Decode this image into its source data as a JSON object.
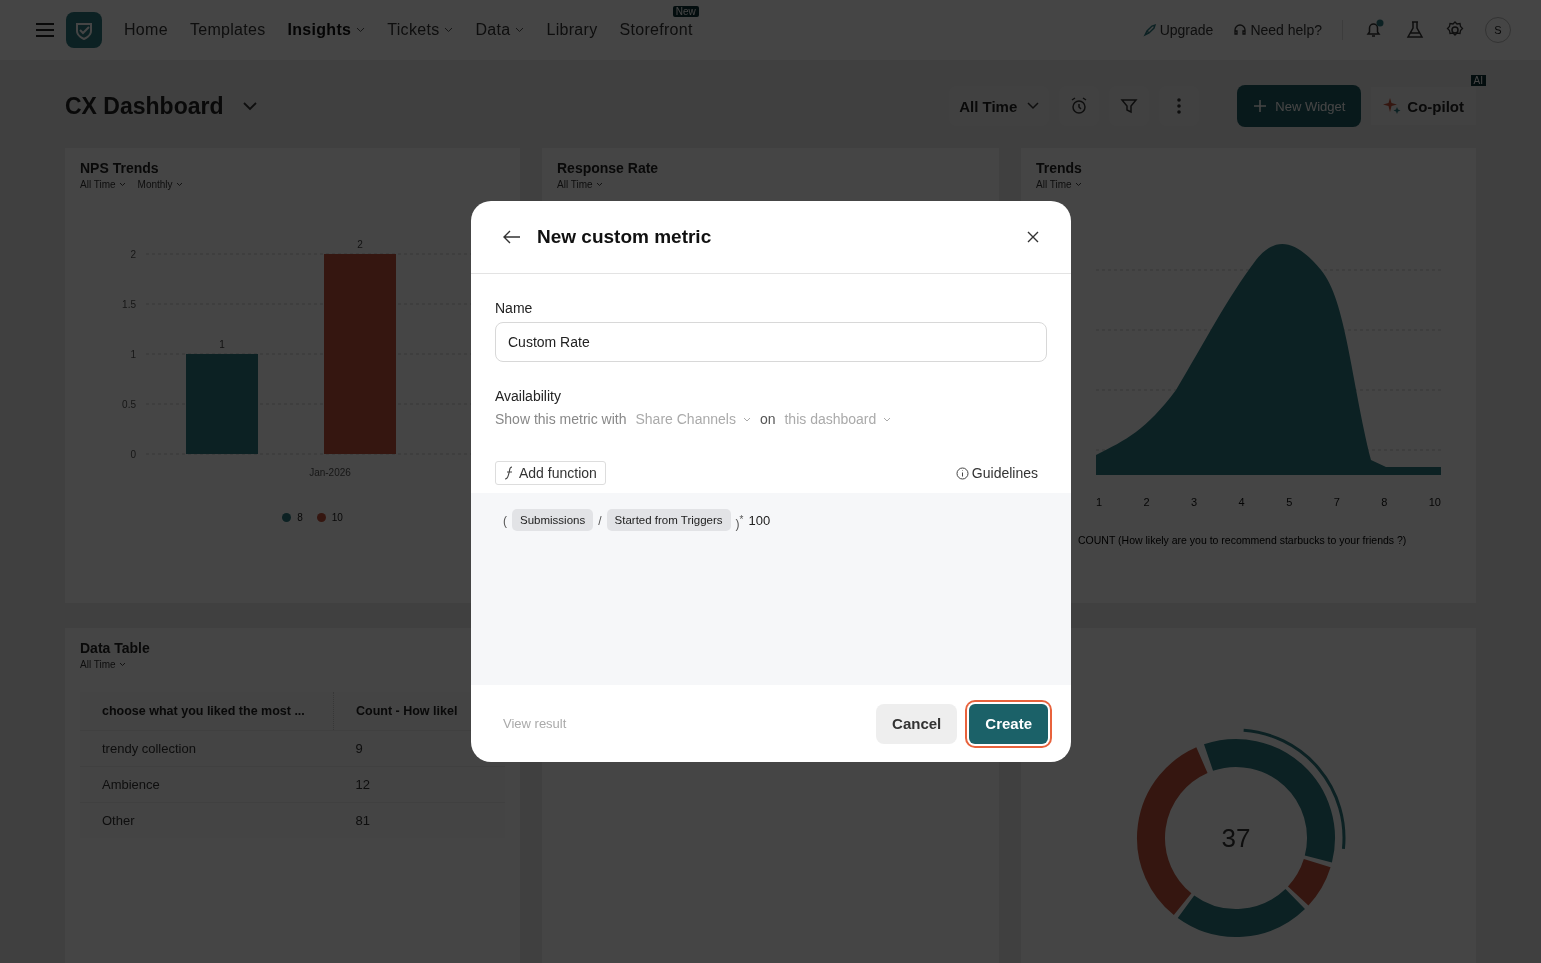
{
  "nav": {
    "items": [
      {
        "label": "Home",
        "selected": false,
        "dropdown": false
      },
      {
        "label": "Templates",
        "selected": false,
        "dropdown": false
      },
      {
        "label": "Insights",
        "selected": true,
        "dropdown": true
      },
      {
        "label": "Tickets",
        "selected": false,
        "dropdown": true
      },
      {
        "label": "Data",
        "selected": false,
        "dropdown": true
      },
      {
        "label": "Library",
        "selected": false,
        "dropdown": false
      },
      {
        "label": "Storefront",
        "selected": false,
        "dropdown": false,
        "badge": "New"
      }
    ],
    "upgrade": "Upgrade",
    "help": "Need help?",
    "notifications_unread": true,
    "avatar": "S"
  },
  "dashboard": {
    "title": "CX Dashboard",
    "period": "All Time",
    "new_widget": "New Widget",
    "copilot": "Co-pilot",
    "copilot_badge": "AI"
  },
  "widgets": {
    "nps": {
      "title": "NPS Trends",
      "filters": [
        "All Time",
        "Monthly"
      ],
      "chart_data": {
        "type": "bar",
        "categories": [
          "Jan-2026"
        ],
        "series": [
          {
            "name": "8",
            "color": "#2b7a80",
            "values": [
              1
            ]
          },
          {
            "name": "10",
            "color": "#c4533a",
            "values": [
              2
            ]
          }
        ],
        "ylim": [
          0,
          2
        ],
        "yticks": [
          0,
          0.5,
          1,
          1.5,
          2
        ],
        "data_labels": true,
        "grid": true
      }
    },
    "response": {
      "title": "Response Rate",
      "filters": [
        "All Time"
      ]
    },
    "trends": {
      "title": "Trends",
      "filters": [
        "All Time"
      ],
      "x_tick_labels": [
        "1",
        "2",
        "3",
        "4",
        "5",
        "7",
        "8",
        "10"
      ],
      "axis_title": "COUNT (How likely are you to recommend starbucks to your friends ?)"
    },
    "table": {
      "title": "Data Table",
      "filters": [
        "All Time"
      ],
      "columns": [
        "choose what you liked the most ...",
        "Count - How likel"
      ],
      "rows": [
        [
          "trendy collection",
          "9"
        ],
        [
          "Ambience",
          "12"
        ],
        [
          "Other",
          "81"
        ]
      ]
    },
    "donut": {
      "center": "37"
    }
  },
  "modal": {
    "title": "New custom metric",
    "name_label": "Name",
    "name_value": "Custom Rate",
    "availability_label": "Availability",
    "availability": {
      "prefix": "Show this metric with",
      "channel": "Share Channels",
      "joiner": "on",
      "scope": "this dashboard"
    },
    "add_function": "Add function",
    "guidelines": "Guidelines",
    "formula": [
      {
        "kind": "paren",
        "text": "("
      },
      {
        "kind": "chip",
        "text": "Submissions"
      },
      {
        "kind": "operator",
        "text": "/"
      },
      {
        "kind": "chip",
        "text": "Started from Triggers"
      },
      {
        "kind": "operator",
        "text": ")$^{*}$"
      },
      {
        "kind": "number",
        "text": "100"
      }
    ],
    "view_result": {
      "label": "View result",
      "disabled": true
    },
    "cancel": "Cancel",
    "create": {
      "label": "Create",
      "focused": true
    }
  }
}
